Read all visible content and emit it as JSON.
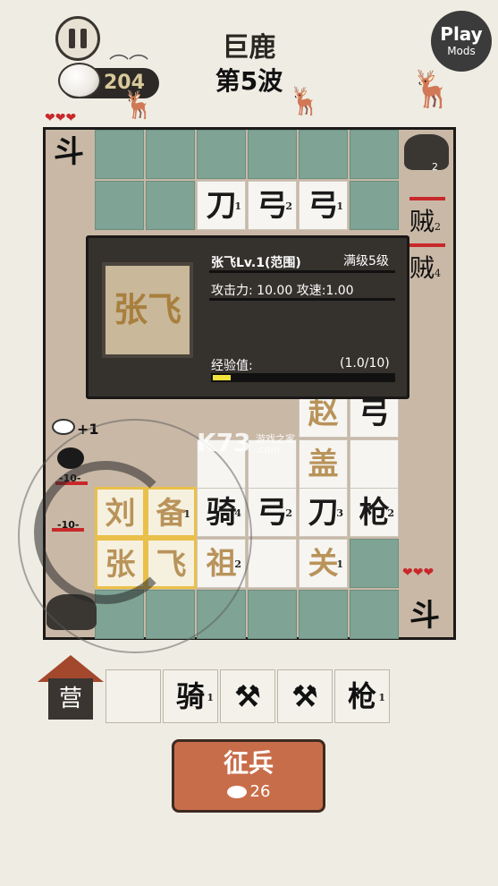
{
  "header": {
    "title": "巨鹿",
    "wave": "第5波",
    "coins": "204",
    "play_mods_line1": "Play",
    "play_mods_line2": "Mods",
    "hearts_top": "❤❤❤",
    "hearts_bottom": "❤❤❤"
  },
  "icons": {
    "pause": "pause-icon",
    "coin": "steamed-bun-icon",
    "bird": "bird-icon",
    "deer": "deer-icon"
  },
  "board": {
    "ally_flag": "斗",
    "enemy_flag": "斗",
    "rock_count": "2",
    "row2": [
      {
        "ch": "刀",
        "lvl": "1"
      },
      {
        "ch": "弓",
        "lvl": "2"
      },
      {
        "ch": "弓",
        "lvl": "1"
      }
    ],
    "enemies_right": [
      {
        "ch": "贼",
        "lvl": "2"
      },
      {
        "ch": "贼",
        "lvl": "4"
      }
    ],
    "mid_units": [
      {
        "ch": "赵",
        "lvl": ""
      },
      {
        "ch": "弓",
        "lvl": ""
      },
      {
        "ch": "盖",
        "lvl": ""
      }
    ],
    "row_a": [
      {
        "ch": "刘",
        "lvl": ""
      },
      {
        "ch": "备",
        "lvl": "1"
      },
      {
        "ch": "骑",
        "lvl": "4"
      },
      {
        "ch": "弓",
        "lvl": "2"
      },
      {
        "ch": "刀",
        "lvl": "3"
      },
      {
        "ch": "枪",
        "lvl": "2"
      }
    ],
    "row_b": [
      {
        "ch": "张",
        "lvl": ""
      },
      {
        "ch": "飞",
        "lvl": ""
      },
      {
        "ch": "祖",
        "lvl": "2"
      },
      {
        "ch": "关",
        "lvl": "1"
      }
    ],
    "left_enemies": [
      "-10-",
      "-10-"
    ],
    "plus_coin": "+1"
  },
  "tooltip": {
    "portrait": "张飞",
    "name": "张飞Lv.1(范围)",
    "max_level": "满级5级",
    "stats": "攻击力: 10.00 攻速:1.00",
    "xp_label": "经验值:",
    "xp_value": "(1.0/10)",
    "xp_fraction": 0.1
  },
  "watermark": {
    "logo": "K73",
    "site": "游戏之家",
    "domain": ".com"
  },
  "bottom": {
    "camp": "营",
    "slots": [
      {
        "ch": "",
        "lvl": ""
      },
      {
        "ch": "骑",
        "lvl": "1"
      },
      {
        "ch": "⚒",
        "lvl": ""
      },
      {
        "ch": "⚒",
        "lvl": ""
      },
      {
        "ch": "枪",
        "lvl": "1"
      }
    ],
    "recruit_label": "征兵",
    "recruit_cost": "26"
  }
}
